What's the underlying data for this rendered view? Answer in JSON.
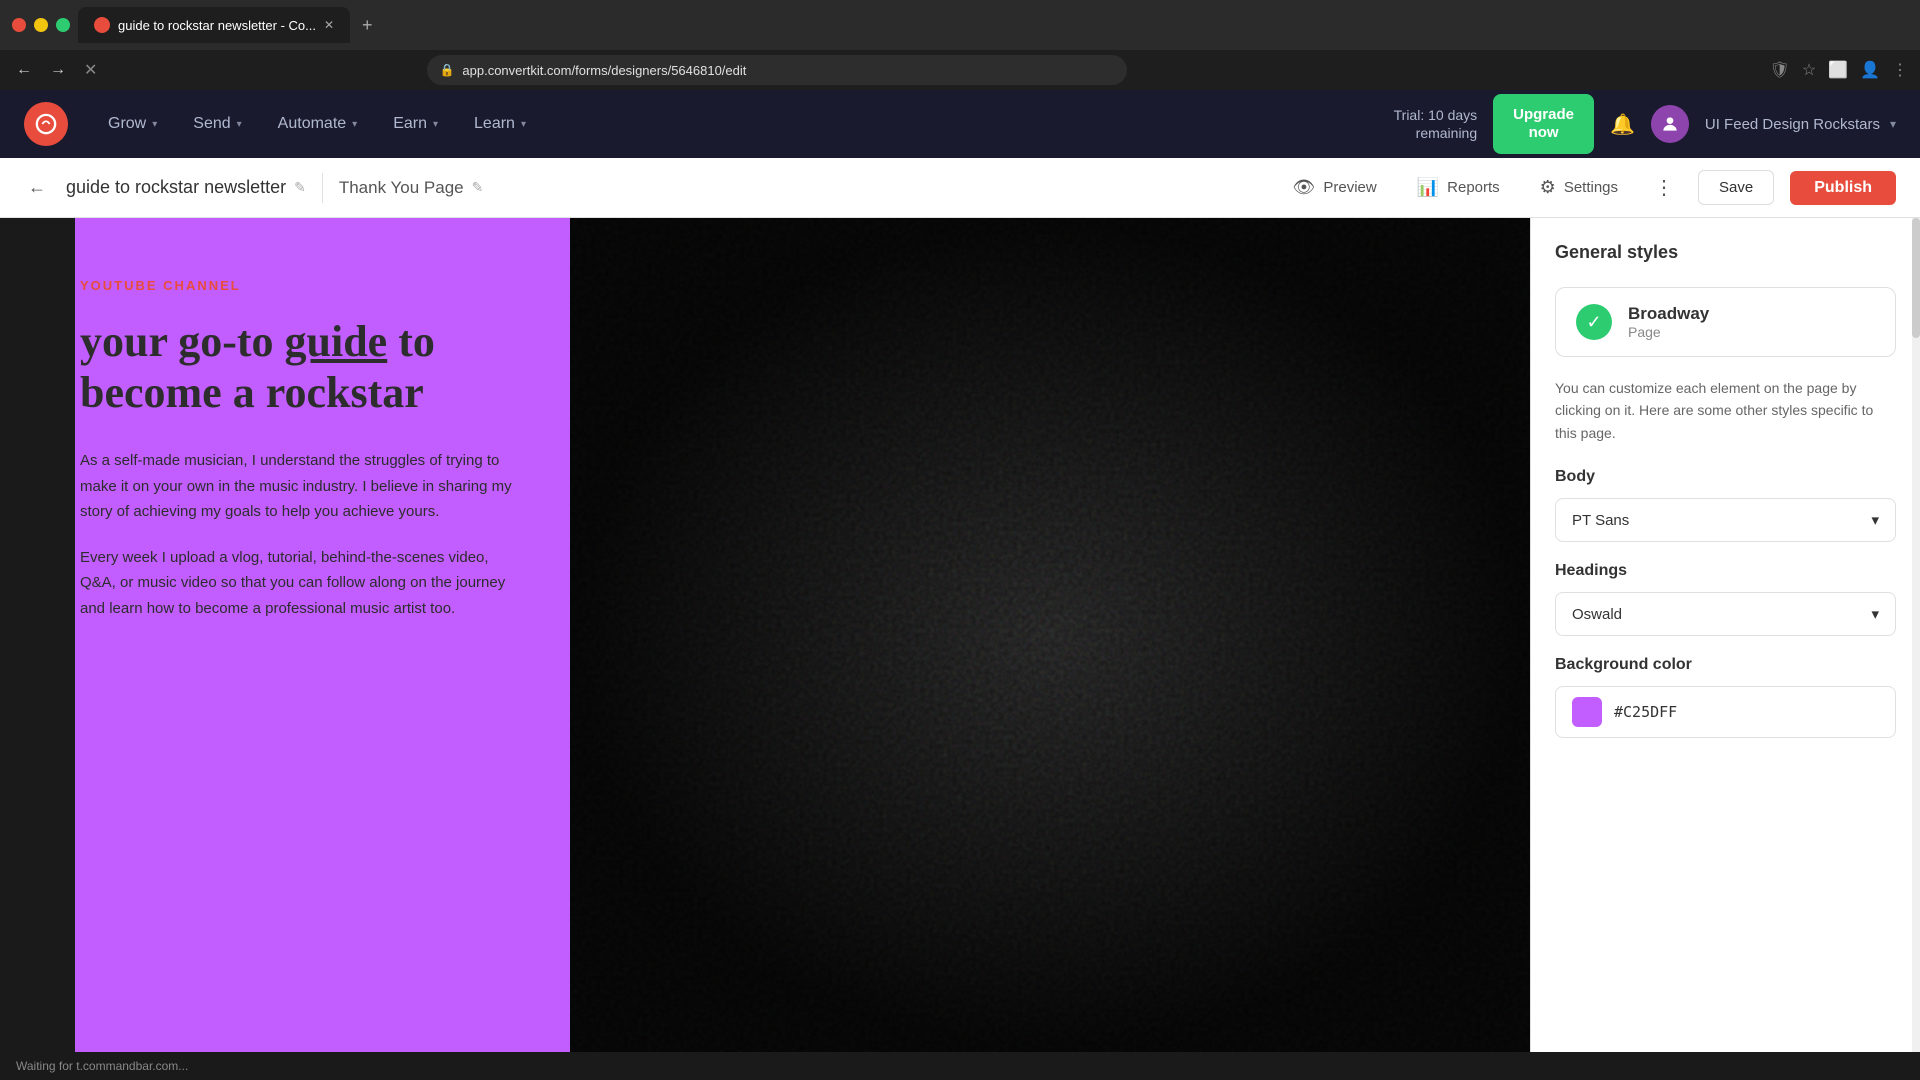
{
  "browser": {
    "tab_title": "guide to rockstar newsletter - Co...",
    "url": "app.convertkit.com/forms/designers/5646810/edit",
    "new_tab_label": "+"
  },
  "nav": {
    "logo_icon": "●",
    "items": [
      {
        "label": "Grow",
        "has_dropdown": true
      },
      {
        "label": "Send",
        "has_dropdown": true
      },
      {
        "label": "Automate",
        "has_dropdown": true
      },
      {
        "label": "Earn",
        "has_dropdown": true
      },
      {
        "label": "Learn",
        "has_dropdown": true
      }
    ],
    "trial_text_line1": "Trial: 10 days",
    "trial_text_line2": "remaining",
    "upgrade_label_line1": "Upgrade",
    "upgrade_label_line2": "now",
    "username": "UI Feed Design Rockstars"
  },
  "toolbar": {
    "back_icon": "←",
    "form_title": "guide to rockstar newsletter",
    "edit_icon": "✎",
    "page_tab": "Thank You Page",
    "page_tab_edit_icon": "✎",
    "preview_label": "Preview",
    "reports_label": "Reports",
    "settings_label": "Settings",
    "more_icon": "⋮",
    "save_label": "Save",
    "publish_label": "Publish"
  },
  "canvas": {
    "youtube_label": "YOUTUBE CHANNEL",
    "headline_part1": "your go-to ",
    "headline_underline": "guide",
    "headline_part2": " to become a rockstar",
    "body_text_1": "As a self-made musician, I understand the struggles of trying to make it on your own in the music industry. I believe in sharing my story of achieving my goals to help you achieve yours.",
    "body_text_2": "Every week I upload a vlog, tutorial, behind-the-scenes video, Q&A, or music video so that you can follow along on the journey and learn how to become a professional music artist too."
  },
  "right_panel": {
    "title": "General styles",
    "style_card": {
      "name": "Broadway",
      "type": "Page",
      "check_icon": "✓"
    },
    "description": "You can customize each element on the page by clicking on it. Here are some other styles specific to this page.",
    "body_section": {
      "label": "Body",
      "font_value": "PT Sans",
      "dropdown_icon": "▾"
    },
    "headings_section": {
      "label": "Headings",
      "font_value": "Oswald",
      "dropdown_icon": "▾"
    },
    "bg_color_section": {
      "label": "Background color",
      "color_hex": "#C25DFF",
      "color_swatch": "#C25DFF"
    }
  },
  "status_bar": {
    "text": "Waiting for t.commandbar.com..."
  },
  "colors": {
    "nav_bg": "#1a1a2e",
    "accent_red": "#e74c3c",
    "accent_green": "#2ecc71",
    "canvas_purple": "#c25dff",
    "upgrade_green": "#2ecc71"
  }
}
